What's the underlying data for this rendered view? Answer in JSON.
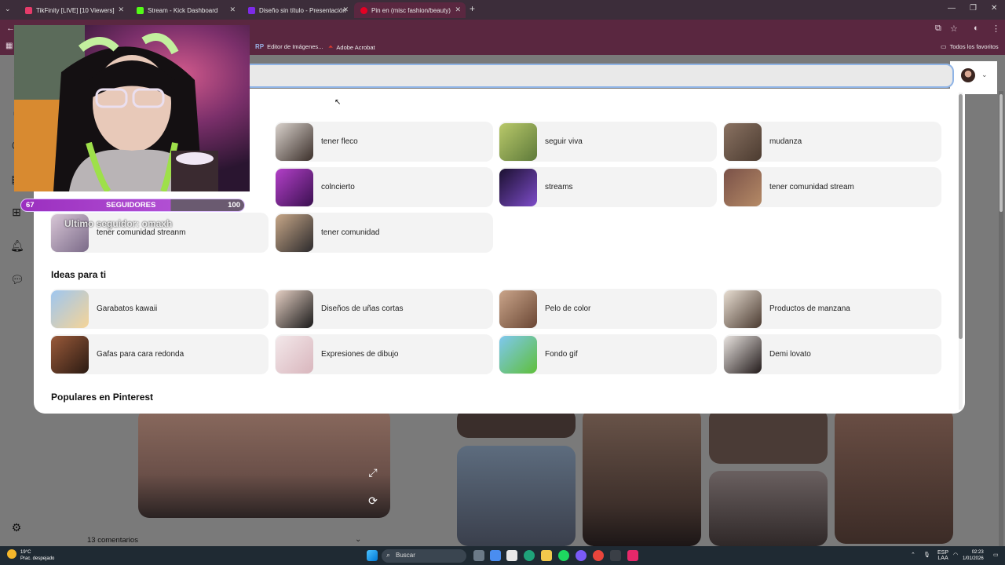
{
  "tabs": [
    {
      "title": "TikFinity [LIVE] [10 Viewers]",
      "color": "#e63b6a"
    },
    {
      "title": "Stream - Kick Dashboard",
      "color": "#53fc18"
    },
    {
      "title": "Diseño sin título - Presentación",
      "color": "#7d2ae8"
    },
    {
      "title": "Pin en (misc fashion/beauty)",
      "color": "#e60023",
      "active": true
    }
  ],
  "bookmarks": [
    {
      "label": "Editor de Imágenes...",
      "icon": "RP"
    },
    {
      "label": "Adobe Acrobat",
      "icon": "acrobat-icon"
    }
  ],
  "bookmarks_right": "Todos los favoritos",
  "recent_searches": [
    {
      "label": "tener fleco",
      "thumb": [
        "#d9d2cc",
        "#3b2f2a"
      ]
    },
    {
      "label": "seguir viva",
      "thumb": [
        "#b9c96a",
        "#5e7a3a"
      ]
    },
    {
      "label": "mudanza",
      "thumb": [
        "#8a7262",
        "#4b3b30"
      ]
    },
    {
      "label": "colncierto",
      "thumb": [
        "#b340c8",
        "#3a1050"
      ]
    },
    {
      "label": "streams",
      "thumb": [
        "#1b1030",
        "#7d4cc9"
      ]
    },
    {
      "label": "tener comunidad stream",
      "thumb": [
        "#7a5148",
        "#b58a66"
      ]
    },
    {
      "label": "tener comunidad streanm",
      "thumb": [
        "#d8c6d6",
        "#7a6a88"
      ]
    },
    {
      "label": "tener comunidad",
      "thumb": [
        "#c7a788",
        "#2c2a2c"
      ]
    }
  ],
  "ideas_title": "Ideas para ti",
  "ideas": [
    {
      "label": "Garabatos kawaii",
      "thumb": [
        "#9ec6f0",
        "#f5d497"
      ]
    },
    {
      "label": "Diseños de uñas cortas",
      "thumb": [
        "#e6d0c4",
        "#1a1a1a"
      ]
    },
    {
      "label": "Pelo de color",
      "thumb": [
        "#caa58a",
        "#6a4634"
      ]
    },
    {
      "label": "Productos de manzana",
      "thumb": [
        "#e8ded2",
        "#4a3a30"
      ]
    },
    {
      "label": "Gafas para cara redonda",
      "thumb": [
        "#9a5a3a",
        "#2a1a12"
      ]
    },
    {
      "label": "Expresiones de dibujo",
      "thumb": [
        "#f3e8ea",
        "#d9b6bd"
      ]
    },
    {
      "label": "Fondo gif",
      "thumb": [
        "#7fc8f0",
        "#5fbf3a"
      ]
    },
    {
      "label": "Demi lovato",
      "thumb": [
        "#e9e4e0",
        "#221a1a"
      ]
    }
  ],
  "popular_title": "Populares en Pinterest",
  "comments_label": "13 comentarios",
  "overlay": {
    "followers_current": "67",
    "followers_label": "SEGUIDORES",
    "followers_goal": "100",
    "follower_progress": 0.67,
    "last_follower": "Ultimo seguidor: omaxh"
  },
  "taskbar": {
    "weather_temp": "19°C",
    "weather_desc": "Prac. despejado",
    "search_placeholder": "Buscar",
    "lang": "ESP",
    "lang2": "LAA",
    "time": "02:23",
    "date": "1/01/2026"
  }
}
